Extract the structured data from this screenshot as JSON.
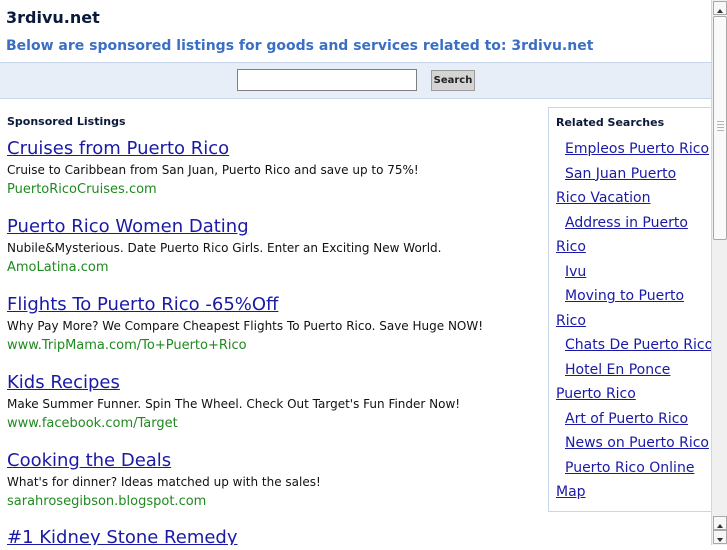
{
  "site": {
    "title": "3rdivu.net",
    "tagline": "Below are sponsored listings for goods and services related to: 3rdivu.net"
  },
  "search": {
    "value": "",
    "button_label": "Search"
  },
  "sponsored": {
    "heading": "Sponsored Listings",
    "listings": [
      {
        "title": "Cruises from Puerto Rico",
        "desc": "Cruise to Caribbean from San Juan, Puerto Rico and save up to 75%!",
        "url": "PuertoRicoCruises.com"
      },
      {
        "title": "Puerto Rico Women Dating",
        "desc": "Nubile&Mysterious. Date Puerto Rico Girls. Enter an Exciting New World.",
        "url": "AmoLatina.com"
      },
      {
        "title": "Flights To Puerto Rico -65%Off",
        "desc": "Why Pay More? We Compare Cheapest Flights To Puerto Rico. Save Huge NOW!",
        "url": "www.TripMama.com/To+Puerto+Rico"
      },
      {
        "title": "Kids Recipes",
        "desc": "Make Summer Funner. Spin The Wheel. Check Out Target's Fun Finder Now!",
        "url": "www.facebook.com/Target"
      },
      {
        "title": "Cooking the Deals",
        "desc": "What's for dinner? Ideas matched up with the sales!",
        "url": "sarahrosegibson.blogspot.com"
      },
      {
        "title": "#1 Kidney Stone Remedy",
        "desc": "",
        "url": ""
      }
    ]
  },
  "related": {
    "heading": "Related Searches",
    "lines": [
      "Empleos Puerto Rico",
      "San Juan Puerto",
      "Rico Vacation",
      "Address in Puerto",
      "Rico",
      "Ivu",
      "Moving to Puerto",
      "Rico",
      "Chats De Puerto Rico",
      "Hotel En Ponce",
      "Puerto Rico",
      "Art of Puerto Rico",
      "News on Puerto Rico",
      "Puerto Rico Online",
      "Map"
    ]
  }
}
